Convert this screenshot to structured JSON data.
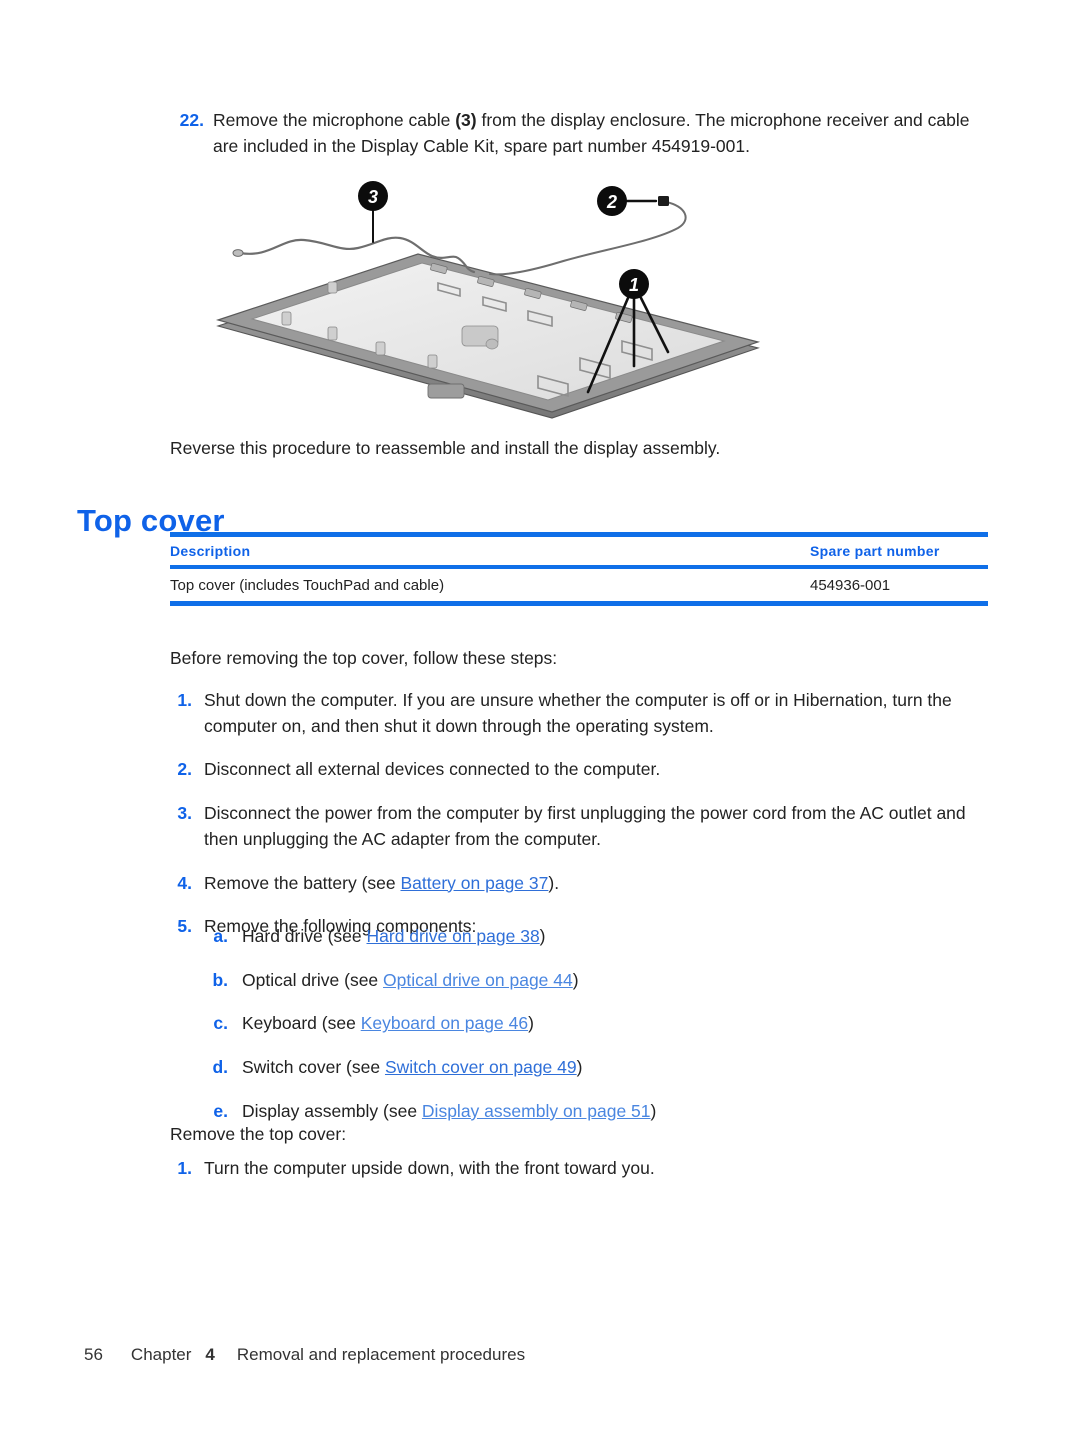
{
  "page": {
    "background": "#ffffff",
    "accent_blue": "#0f62e8",
    "rule_blue": "#0f6fe8",
    "link_blue": "#2f6fd8"
  },
  "step22": {
    "number": "22.",
    "text_part1": "Remove the microphone cable ",
    "callout": "(3)",
    "text_part2": " from the display enclosure. The microphone receiver and cable are included in the Display Cable Kit, spare part number 454919-001."
  },
  "illustration": {
    "alt": "Display enclosure with wireless antenna cables and microphone cable",
    "callouts": [
      {
        "id": "1",
        "label": "1"
      },
      {
        "id": "2",
        "label": "2"
      },
      {
        "id": "3",
        "label": "3"
      }
    ],
    "colors": {
      "enclosure_rim": "#8d8d8d",
      "enclosure_inner": "#e9e9e9",
      "cable": "#6e6e6e",
      "callout_fill": "#0c0c0c",
      "callout_text": "#ffffff"
    }
  },
  "reverse_line": {
    "text": "Reverse this procedure to reassemble and install the display assembly."
  },
  "section": {
    "heading": "Top cover"
  },
  "parts_table": {
    "headers": {
      "description": "Description",
      "spare_part_number": "Spare part number"
    },
    "rows": [
      {
        "description": "Top cover (includes TouchPad and cable)",
        "spare_part_number": "454936-001"
      }
    ]
  },
  "before_text": {
    "text": "Before removing the top cover, follow these steps:"
  },
  "steps_before": [
    {
      "number": "1.",
      "text": "Shut down the computer. If you are unsure whether the computer is off or in Hibernation, turn the computer on, and then shut it down through the operating system."
    },
    {
      "number": "2.",
      "text": "Disconnect all external devices connected to the computer."
    },
    {
      "number": "3.",
      "text": "Disconnect the power from the computer by first unplugging the power cord from the AC outlet and then unplugging the AC adapter from the computer."
    },
    {
      "number": "4.",
      "prefix": "Remove the battery (see ",
      "link": "Battery on page 37",
      "suffix": ")."
    },
    {
      "number": "5.",
      "text": "Remove the following components:"
    }
  ],
  "substeps": [
    {
      "number": "a.",
      "prefix": "Hard drive (see ",
      "link": "Hard drive on page 38",
      "suffix": ")"
    },
    {
      "number": "b.",
      "prefix": "Optical drive (see ",
      "link": "Optical drive on page 44",
      "suffix": ")"
    },
    {
      "number": "c.",
      "prefix": "Keyboard (see ",
      "link": "Keyboard on page 46",
      "suffix": ")"
    },
    {
      "number": "d.",
      "prefix": "Switch cover (see ",
      "link": "Switch cover on page 49",
      "suffix": ")"
    },
    {
      "number": "e.",
      "prefix": "Display assembly (see ",
      "link": "Display assembly on page 51",
      "suffix": ")"
    }
  ],
  "remove_text": {
    "text": "Remove the top cover:"
  },
  "steps_remove": [
    {
      "number": "1.",
      "text": "Turn the computer upside down, with the front toward you."
    }
  ],
  "footer": {
    "page_number": "56",
    "chapter_word": "Chapter",
    "chapter_number": "4",
    "chapter_title": "Removal and replacement procedures"
  }
}
